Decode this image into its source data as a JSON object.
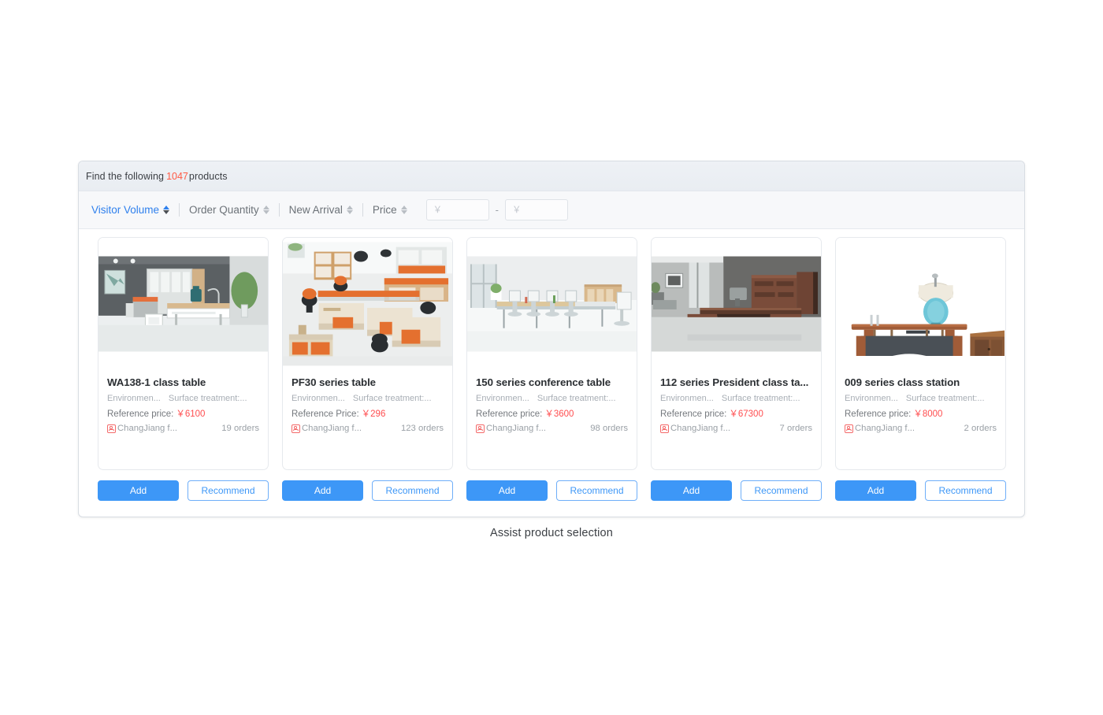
{
  "header": {
    "prefix": "Find the following ",
    "count": "1047",
    "suffix": "products"
  },
  "filters": {
    "items": [
      {
        "label": "Visitor Volume",
        "active": true
      },
      {
        "label": "Order Quantity",
        "active": false
      },
      {
        "label": "New Arrival",
        "active": false
      },
      {
        "label": "Price",
        "active": false
      }
    ],
    "price_min_placeholder": "￥",
    "price_min_value": "",
    "price_max_placeholder": "￥",
    "price_max_value": "",
    "range_separator": "-"
  },
  "buttons": {
    "add": "Add",
    "recommend": "Recommend"
  },
  "products": [
    {
      "title": "WA138-1 class table",
      "attr1": "Environmen...",
      "attr2": "Surface treatment:...",
      "price_label": "Reference price:",
      "price": "￥6100",
      "shop": "ChangJiang f...",
      "orders": "19 orders"
    },
    {
      "title": "PF30 series table",
      "attr1": "Environmen...",
      "attr2": "Surface treatment:...",
      "price_label": "Reference Price:",
      "price": "￥296",
      "shop": "ChangJiang f...",
      "orders": "123 orders"
    },
    {
      "title": "150 series conference table",
      "attr1": "Environmen...",
      "attr2": "Surface treatment:...",
      "price_label": "Reference price:",
      "price": "￥3600",
      "shop": "ChangJiang f...",
      "orders": "98 orders"
    },
    {
      "title": "112 series President class ta...",
      "attr1": "Environmen...",
      "attr2": "Surface treatment:...",
      "price_label": "Reference price:",
      "price": "￥67300",
      "shop": "ChangJiang f...",
      "orders": "7 orders"
    },
    {
      "title": "009 series class station",
      "attr1": "Environmen...",
      "attr2": "Surface treatment:...",
      "price_label": "Reference price:",
      "price": "￥8000",
      "shop": "ChangJiang f...",
      "orders": "2 orders"
    }
  ],
  "caption": "Assist product selection",
  "colors": {
    "accent": "#3d97f7",
    "price": "#ff4d4f",
    "count": "#ff5a44",
    "active_filter": "#2f80ed"
  }
}
